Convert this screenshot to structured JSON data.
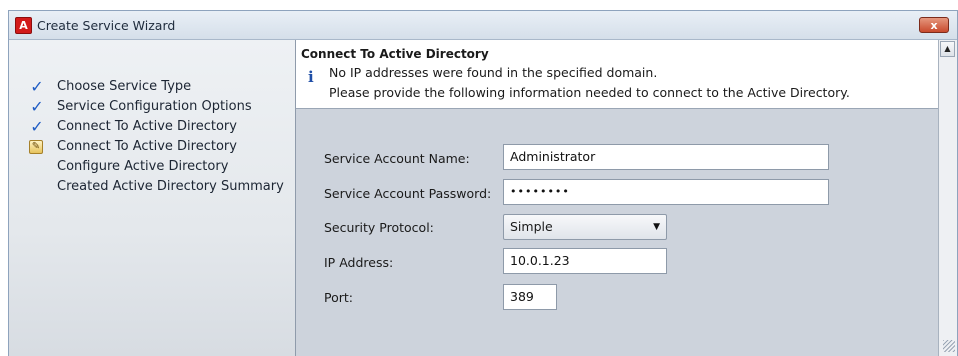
{
  "window": {
    "title": "Create Service Wizard",
    "close_label": "x"
  },
  "sidebar": {
    "steps": [
      {
        "label": "Choose Service Type",
        "status": "done",
        "icon": "checkmark-icon"
      },
      {
        "label": "Service Configuration Options",
        "status": "done",
        "icon": "checkmark-icon"
      },
      {
        "label": "Connect To Active Directory",
        "status": "done",
        "icon": "checkmark-icon"
      },
      {
        "label": "Connect To Active Directory",
        "status": "current",
        "icon": "edit-page-icon"
      },
      {
        "label": "Configure Active Directory",
        "status": "pending",
        "icon": ""
      },
      {
        "label": "Created Active Directory Summary",
        "status": "pending",
        "icon": ""
      }
    ]
  },
  "header": {
    "title": "Connect To Active Directory",
    "info_glyph": "i",
    "line1": "No IP addresses were found in the specified domain.",
    "line2": "Please provide the following information needed to connect to the Active Directory."
  },
  "form": {
    "account_name_label": "Service Account Name:",
    "account_name_value": "Administrator",
    "password_label": "Service Account Password:",
    "password_value": "••••••••",
    "protocol_label": "Security Protocol:",
    "protocol_value": "Simple",
    "ip_label": "IP Address:",
    "ip_value": "10.0.1.23",
    "port_label": "Port:",
    "port_value": "389"
  },
  "colors": {
    "accent": "#1f5cc4",
    "close": "#c84a2d",
    "app_icon": "#d21a1a"
  }
}
